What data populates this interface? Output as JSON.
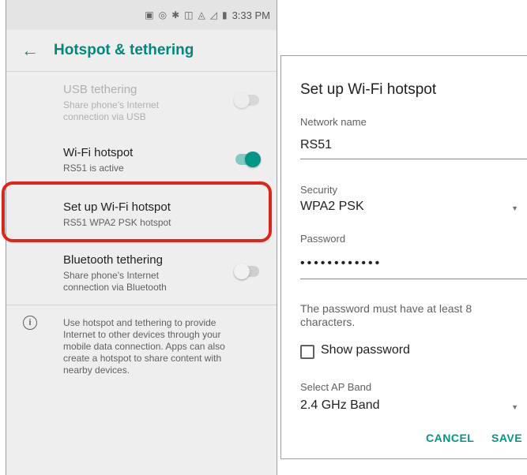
{
  "status_bar": {
    "time": "3:33 PM"
  },
  "app_bar": {
    "title": "Hotspot & tethering"
  },
  "settings": [
    {
      "title": "USB tethering",
      "subtitle_line1": "Share phone's Internet",
      "subtitle_line2": "connection via USB",
      "state": "disabled"
    },
    {
      "title": "Wi-Fi hotspot",
      "subtitle_line1": "RS51 is active",
      "state": "on"
    },
    {
      "title": "Set up Wi-Fi hotspot",
      "subtitle_line1": "RS51 WPA2 PSK hotspot"
    },
    {
      "title": "Bluetooth tethering",
      "subtitle_line1": "Share phone's Internet",
      "subtitle_line2": "connection via Bluetooth",
      "state": "off"
    }
  ],
  "info": {
    "lines": [
      "Use hotspot and tethering to provide",
      "Internet to other devices through your",
      "mobile data connection. Apps can also",
      "create a hotspot to share content with",
      "nearby devices."
    ]
  },
  "dialog": {
    "title": "Set up Wi-Fi hotspot",
    "network_name_label": "Network name",
    "network_name_value": "RS51",
    "security_label": "Security",
    "security_value": "WPA2 PSK",
    "password_label": "Password",
    "password_value": "••••••••••••",
    "hint_line1": "The password must have at least 8",
    "hint_line2": "characters.",
    "show_password_label": "Show password",
    "ap_band_label": "Select AP Band",
    "ap_band_value": "2.4 GHz Band",
    "cancel_label": "CANCEL",
    "save_label": "SAVE"
  },
  "colors": {
    "accent": "#009688",
    "highlight": "#e2231a"
  }
}
